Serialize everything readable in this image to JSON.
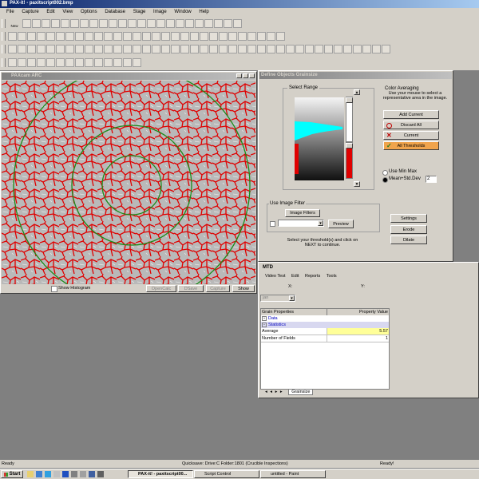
{
  "app": {
    "title": "PAX-it! - paxitscript002.bmp"
  },
  "menu": [
    "File",
    "Capture",
    "Edit",
    "View",
    "Options",
    "Database",
    "Stage",
    "Image",
    "Window",
    "Help"
  ],
  "toolbar": {
    "new_label": "New"
  },
  "image_window": {
    "title": "PAXcam ARC"
  },
  "image_footer": {
    "show_histogram": "Show Histogram",
    "opencalc": "OpenCalc",
    "save": "DSave",
    "capture": "Capture",
    "show": "Show"
  },
  "define_dialog": {
    "title": "Define Objects Grainsize",
    "select_range": "Select Range",
    "color_averaging": "Color Averaging",
    "color_hint": "Use your mouse to select a representative area in the image.",
    "add_current": "Add Current",
    "discard_all": "Discard All",
    "current": "Current",
    "all_thresholds": "All Thresholds",
    "use_min_max": "Use Min Max",
    "mean_std": "Mean+Std.Dev",
    "std_value": "2",
    "use_image_filter": "Use Image Filter",
    "image_filters": "Image Filters",
    "preview": "Preview",
    "instruction": "Select your threshold(s) and click on NEXT to continue.",
    "settings": "Settings",
    "erode": "Erode",
    "dilate": "Dilate"
  },
  "mtd": {
    "title": "MTD",
    "menu": [
      "Video Test",
      "Edit",
      "Reports",
      "Tools"
    ],
    "x_label": "X:",
    "y_label": "Y:",
    "combo_value": "jan",
    "col_props": "Grain Properties",
    "col_value": "Property Value",
    "data_label": "Data",
    "stats_label": "Statistics",
    "rows": [
      {
        "name": "Average",
        "value": "5.57"
      },
      {
        "name": "Number of Fields",
        "value": "1"
      }
    ],
    "tab": "Grainsize"
  },
  "status": {
    "left": "Ready",
    "mid": "Quicksave: Drive:C Folder:1801 (Crucible Inspections)",
    "right": "Ready!"
  },
  "taskbar": {
    "start": "Start",
    "tasks": [
      "PAX-it! - paxitscript00...",
      "Script Control",
      "untitled - Paint"
    ]
  },
  "colors": {
    "title": "#0a246a",
    "face": "#d4d0c8",
    "desktop": "#808080",
    "highlight": "#ffff99",
    "threshold_red": "#e00000",
    "circle_green": "#1a8c1a",
    "cyan": "#00ffff"
  }
}
